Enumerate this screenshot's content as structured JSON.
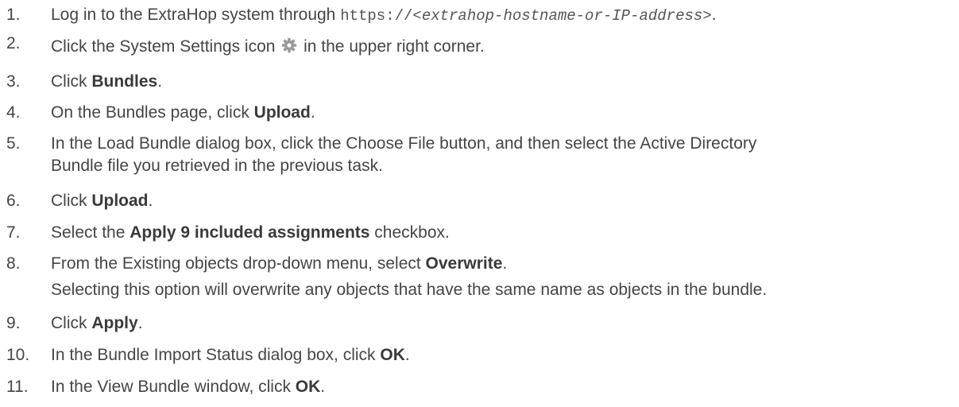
{
  "steps": [
    {
      "number": "1.",
      "parts": {
        "pre": "Log in to the ExtraHop system through ",
        "code_prefix": "https://",
        "code_var": "<extrahop-hostname-or-IP-address>",
        "post": "."
      }
    },
    {
      "number": "2.",
      "parts": {
        "pre": "Click the System Settings icon ",
        "icon": "gear-icon",
        "post": " in the upper right corner."
      }
    },
    {
      "number": "3.",
      "parts": {
        "pre": "Click ",
        "bold": "Bundles",
        "post": "."
      }
    },
    {
      "number": "4.",
      "parts": {
        "pre": "On the Bundles page, click ",
        "bold": "Upload",
        "post": "."
      }
    },
    {
      "number": "5.",
      "parts": {
        "line1": "In the Load Bundle dialog box, click the Choose File button, and then select the Active Directory",
        "line2": "Bundle file you retrieved in the previous task."
      }
    },
    {
      "number": "6.",
      "parts": {
        "pre": "Click ",
        "bold": "Upload",
        "post": "."
      }
    },
    {
      "number": "7.",
      "parts": {
        "pre": "Select the ",
        "bold": "Apply 9 included assignments",
        "post": " checkbox."
      }
    },
    {
      "number": "8.",
      "parts": {
        "pre": "From the Existing objects drop-down menu, select ",
        "bold": "Overwrite",
        "post": ".",
        "note": "Selecting this option will overwrite any objects that have the same name as objects in the bundle."
      }
    },
    {
      "number": "9.",
      "parts": {
        "pre": "Click ",
        "bold": "Apply",
        "post": "."
      }
    },
    {
      "number": "10.",
      "parts": {
        "pre": "In the Bundle Import Status dialog box, click ",
        "bold": "OK",
        "post": "."
      }
    },
    {
      "number": "11.",
      "parts": {
        "pre": "In the View Bundle window, click ",
        "bold": "OK",
        "post": "."
      }
    }
  ],
  "colors": {
    "text": "#454545",
    "gear": "#9a9a9a"
  }
}
